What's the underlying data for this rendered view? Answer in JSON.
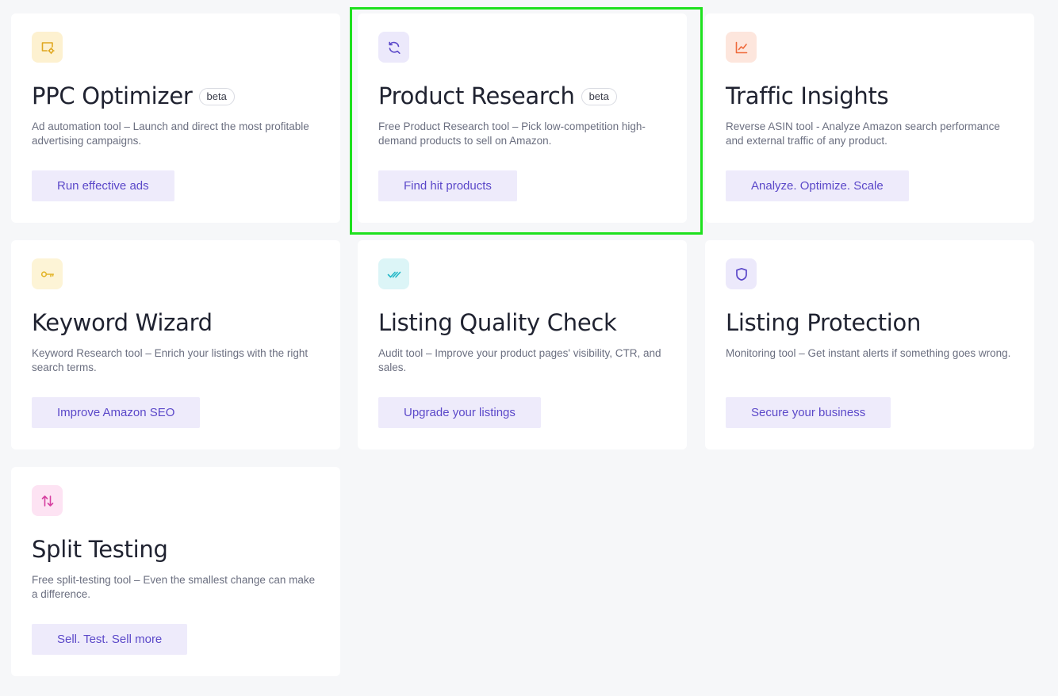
{
  "cards": [
    {
      "title": "PPC Optimizer",
      "badge": "beta",
      "description": "Ad automation tool – Launch and direct the most profitable advertising campaigns.",
      "button": "Run effective ads",
      "icon": "monitor-gear-icon",
      "icon_bg": "#fdf1d0",
      "icon_color": "#e0a821"
    },
    {
      "title": "Product Research",
      "badge": "beta",
      "description": "Free Product Research tool – Pick low-competition high-demand products to sell on Amazon.",
      "button": "Find hit products",
      "icon": "refresh-search-icon",
      "icon_bg": "#ece9fb",
      "icon_color": "#5b48c9"
    },
    {
      "title": "Traffic Insights",
      "badge": "",
      "description": "Reverse ASIN tool - Analyze Amazon search performance and external traffic of any product.",
      "button": "Analyze. Optimize. Scale",
      "icon": "line-chart-icon",
      "icon_bg": "#fde6dd",
      "icon_color": "#ef6a3c"
    },
    {
      "title": "Keyword Wizard",
      "badge": "",
      "description": "Keyword Research tool – Enrich your listings with the right search terms.",
      "button": "Improve Amazon SEO",
      "icon": "key-icon",
      "icon_bg": "#fdf4d6",
      "icon_color": "#e3b52b"
    },
    {
      "title": "Listing Quality Check",
      "badge": "",
      "description": "Audit tool – Improve your product pages' visibility, CTR, and sales.",
      "button": "Upgrade your listings",
      "icon": "double-check-icon",
      "icon_bg": "#dcf5f7",
      "icon_color": "#24b8c8"
    },
    {
      "title": "Listing Protection",
      "badge": "",
      "description": "Monitoring tool – Get instant alerts if something goes wrong.",
      "button": "Secure your business",
      "icon": "shield-icon",
      "icon_bg": "#ece9fb",
      "icon_color": "#5b48c9"
    },
    {
      "title": "Split Testing",
      "badge": "",
      "description": "Free split-testing tool – Even the smallest change can make a difference.",
      "button": "Sell. Test. Sell more",
      "icon": "swap-arrows-icon",
      "icon_bg": "#fde3f3",
      "icon_color": "#d63fa0"
    }
  ],
  "highlight_color": "#1ee11e"
}
